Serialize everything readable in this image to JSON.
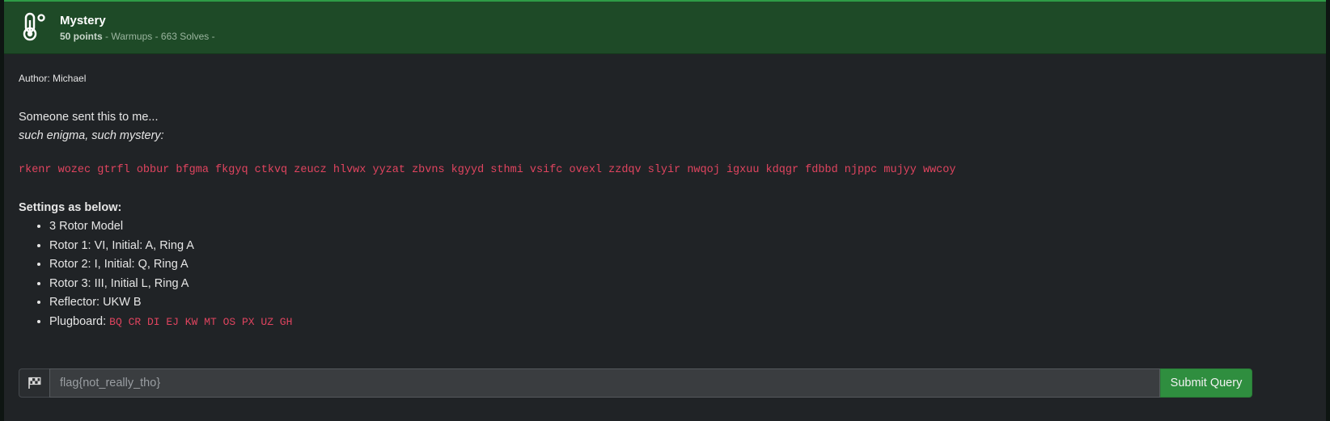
{
  "challenge": {
    "title": "Mystery",
    "points": "50 points",
    "meta_rest": " - Warmups - 663 Solves -",
    "icon": "thermometer-icon"
  },
  "description": {
    "author": "Author: Michael",
    "line1": "Someone sent this to me...",
    "line2": "such enigma, such mystery:",
    "ciphertext": "rkenr wozec gtrfl obbur bfgma fkgyq ctkvq zeucz hlvwx yyzat zbvns kgyyd sthmi vsifc ovexl zzdqv slyir nwqoj igxuu kdqgr fdbbd njppc mujyy wwcoy",
    "settings_heading": "Settings as below:",
    "settings": [
      "3 Rotor Model",
      "Rotor 1: VI, Initial: A, Ring A",
      "Rotor 2: I, Initial: Q, Ring A",
      "Rotor 3: III, Initial L, Ring A",
      "Reflector: UKW B"
    ],
    "plugboard_label": "Plugboard: ",
    "plugboard_value": "BQ CR DI EJ KW MT OS PX UZ GH"
  },
  "flag_form": {
    "icon": "checkered-flag-icon",
    "placeholder": "flag{not_really_tho}",
    "submit_label": "Submit Query"
  },
  "colors": {
    "header_bg": "#1e4a27",
    "accent": "#2f8e3f",
    "code": "#e0445f"
  }
}
